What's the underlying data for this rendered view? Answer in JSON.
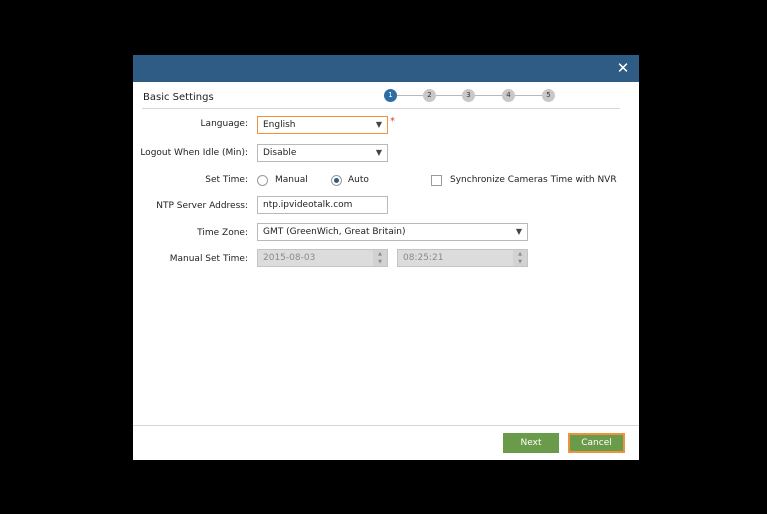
{
  "dialog": {
    "close_symbol": "✕",
    "section_title": "Basic Settings",
    "steps": [
      "1",
      "2",
      "3",
      "4",
      "5"
    ],
    "active_step": 1
  },
  "form": {
    "language": {
      "label": "Language:",
      "value": "English",
      "required_mark": "*"
    },
    "logout": {
      "label": "Logout When Idle (Min):",
      "value": "Disable"
    },
    "set_time": {
      "label": "Set Time:",
      "option_manual": "Manual",
      "option_auto": "Auto",
      "selected": "Auto",
      "sync_label": "Synchronize Cameras Time with NVR",
      "sync_checked": false
    },
    "ntp": {
      "label": "NTP Server Address:",
      "value": "ntp.ipvideotalk.com"
    },
    "timezone": {
      "label": "Time Zone:",
      "value": "GMT (GreenWich, Great Britain)"
    },
    "manual_time": {
      "label": "Manual Set Time:",
      "date": "2015-08-03",
      "time": "08:25:21"
    }
  },
  "buttons": {
    "next": "Next",
    "cancel": "Cancel"
  },
  "icons": {
    "dropdown": "chevron-down-icon",
    "spin_up": "▲",
    "spin_down": "▼",
    "arrow_glyph": "▼"
  },
  "colors": {
    "titlebar": "#2e5c85",
    "button": "#6a9b4a",
    "focus": "#f0923d",
    "required": "#e03a3a"
  }
}
